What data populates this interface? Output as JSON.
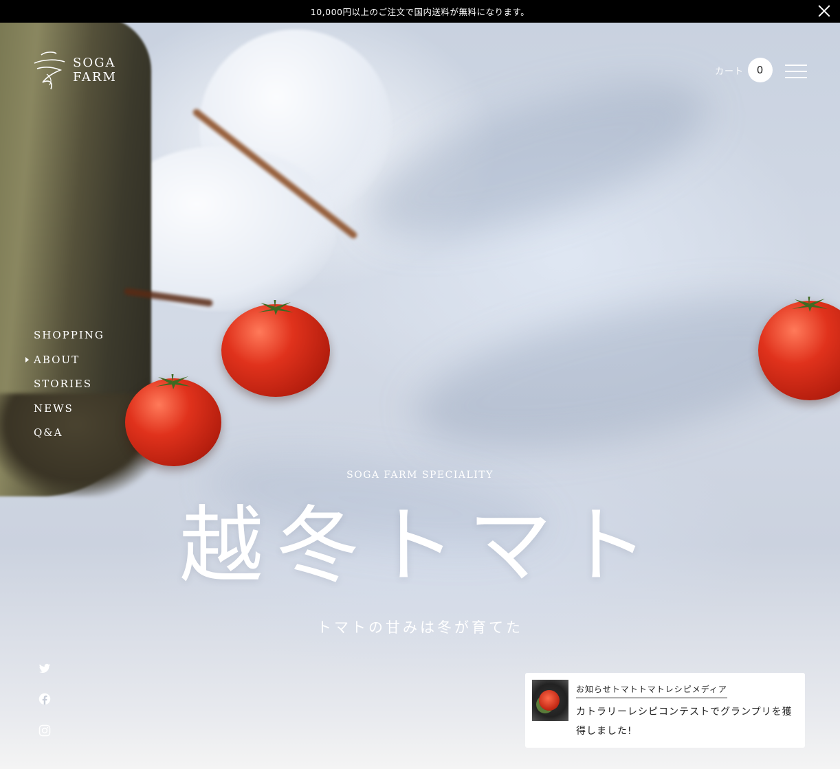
{
  "announcement": {
    "text": "10,000円以上のご注文で国内送料が無料になります。",
    "close_icon": "close-icon"
  },
  "header": {
    "logo_line1": "SOGA",
    "logo_line2": "FARM",
    "cart_label": "カート",
    "cart_count": "0",
    "menu_icon": "hamburger-icon"
  },
  "nav": {
    "items": [
      {
        "label": "SHOPPING",
        "active": false
      },
      {
        "label": "ABOUT",
        "active": true
      },
      {
        "label": "STORIES",
        "active": false
      },
      {
        "label": "NEWS",
        "active": false
      },
      {
        "label": "Q&A",
        "active": false
      }
    ]
  },
  "hero": {
    "kicker": "SOGA FARM SPECIALITY",
    "title": "越冬トマト",
    "tagline": "トマトの甘みは冬が育てた"
  },
  "social": [
    "twitter-icon",
    "facebook-icon",
    "instagram-icon"
  ],
  "news": {
    "tags": "お知らせトマトトマトレシピメディア",
    "title": "カトラリーレシピコンテストでグランプリを獲得しました!"
  },
  "colors": {
    "announcement_bg": "#000000",
    "tomato": "#d42a16",
    "text_light": "#ffffff"
  }
}
